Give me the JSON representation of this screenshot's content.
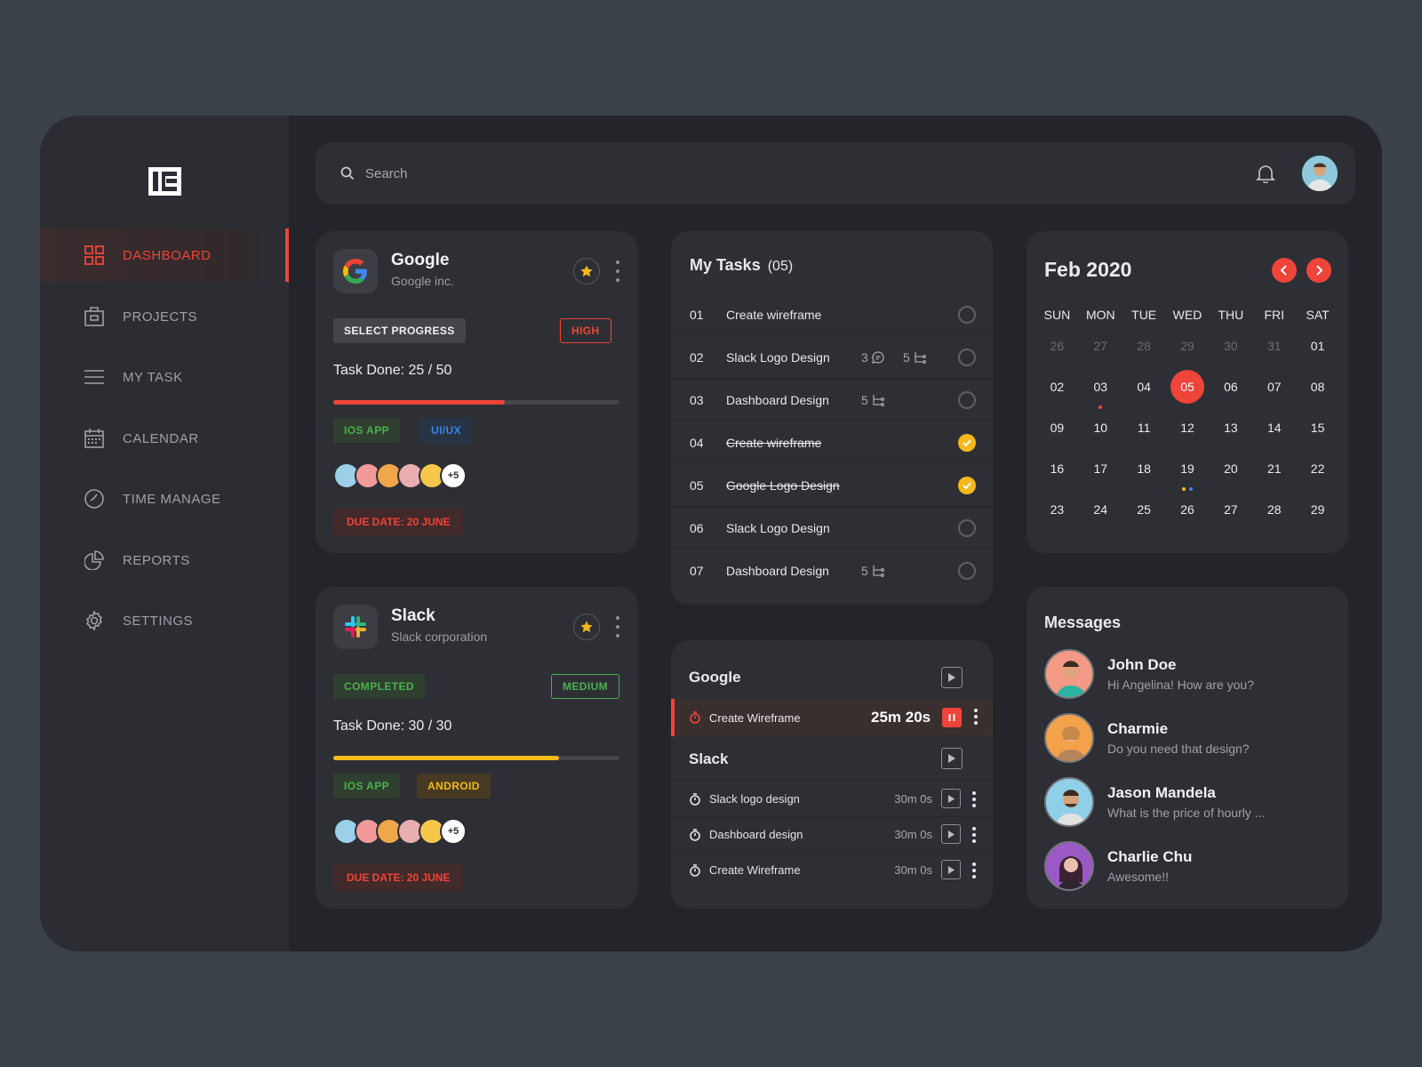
{
  "sidebar": {
    "logo": "13",
    "items": [
      {
        "label": "DASHBOARD"
      },
      {
        "label": "PROJECTS"
      },
      {
        "label": "MY TASK"
      },
      {
        "label": "CALENDAR"
      },
      {
        "label": "TIME MANAGE"
      },
      {
        "label": "REPORTS"
      },
      {
        "label": "SETTINGS"
      }
    ]
  },
  "header": {
    "search_placeholder": "Search"
  },
  "projects": [
    {
      "name": "Google",
      "company": "Google inc.",
      "status": "SELECT PROGRESS",
      "priority": "HIGH",
      "task_done": "Task Done: 25 / 50",
      "progress": 0.6,
      "tags": [
        "IOS APP",
        "UI/UX"
      ],
      "more_members": "+5",
      "due": "DUE DATE: 20 JUNE"
    },
    {
      "name": "Slack",
      "company": "Slack corporation",
      "status": "COMPLETED",
      "priority": "MEDIUM",
      "task_done": "Task Done: 30 / 30",
      "progress": 0.79,
      "tags": [
        "IOS APP",
        "ANDROID"
      ],
      "more_members": "+5",
      "due": "DUE DATE: 20 JUNE"
    }
  ],
  "tasks": {
    "title": "My Tasks",
    "count": "(05)",
    "items": [
      {
        "num": "01",
        "label": "Create wireframe",
        "done": false
      },
      {
        "num": "02",
        "label": "Slack Logo Design",
        "comments": "3",
        "subtasks": "5",
        "done": false
      },
      {
        "num": "03",
        "label": "Dashboard Design",
        "subtasks": "5",
        "done": false
      },
      {
        "num": "04",
        "label": "Create wireframe",
        "done": true
      },
      {
        "num": "05",
        "label": "Google Logo Design",
        "done": true
      },
      {
        "num": "06",
        "label": "Slack Logo Design",
        "done": false
      },
      {
        "num": "07",
        "label": "Dashboard Design",
        "subtasks": "5",
        "done": false
      }
    ]
  },
  "time_manage": {
    "groups": [
      {
        "name": "Google",
        "active": {
          "label": "Create Wireframe",
          "time": "25m 20s"
        }
      },
      {
        "name": "Slack",
        "items": [
          {
            "label": "Slack logo design",
            "time": "30m 0s"
          },
          {
            "label": "Dashboard design",
            "time": "30m 0s"
          },
          {
            "label": "Create Wireframe",
            "time": "30m 0s"
          }
        ]
      }
    ]
  },
  "calendar": {
    "title": "Feb 2020",
    "weekdays": [
      "SUN",
      "MON",
      "TUE",
      "WED",
      "THU",
      "FRI",
      "SAT"
    ],
    "weeks": [
      [
        "26",
        "27",
        "28",
        "29",
        "30",
        "31",
        "01"
      ],
      [
        "02",
        "03",
        "04",
        "05",
        "06",
        "07",
        "08"
      ],
      [
        "09",
        "10",
        "11",
        "12",
        "13",
        "14",
        "15"
      ],
      [
        "16",
        "17",
        "18",
        "19",
        "20",
        "21",
        "22"
      ],
      [
        "23",
        "24",
        "25",
        "26",
        "27",
        "28",
        "29"
      ]
    ],
    "today": "05",
    "colors": {
      "accent": "#ef4439",
      "yellow": "#f6b91a",
      "blue": "#4a7ef0"
    }
  },
  "messages": {
    "title": "Messages",
    "items": [
      {
        "name": "John Doe",
        "text": "Hi Angelina! How are you?"
      },
      {
        "name": "Charmie",
        "text": "Do you need that design?"
      },
      {
        "name": "Jason Mandela",
        "text": "What is the price of hourly ..."
      },
      {
        "name": "Charlie Chu",
        "text": "Awesome!!"
      }
    ]
  }
}
